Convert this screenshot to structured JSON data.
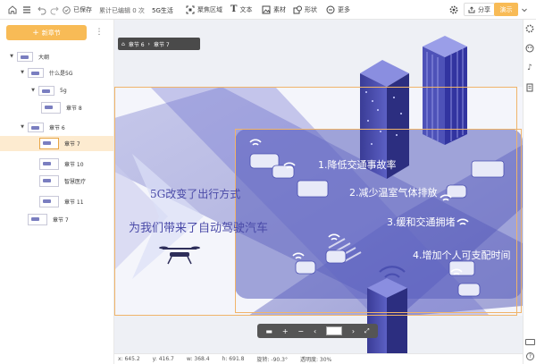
{
  "toolbar": {
    "saved_label": "已保存",
    "edit_count": "累计已编辑 0 次",
    "project_name": "5G生活",
    "focus_label": "聚焦区域",
    "text_label": "文本",
    "material_label": "素材",
    "shape_label": "形状",
    "more_label": "更多",
    "share_label": "分享",
    "present_label": "演示"
  },
  "sidebar": {
    "new_chapter": "新章节",
    "items": [
      {
        "label": "大纲",
        "level": 0
      },
      {
        "label": "什么是5G",
        "level": 1
      },
      {
        "label": "5g",
        "level": 2
      },
      {
        "label": "章节 8",
        "level": 3
      },
      {
        "label": "章节 6",
        "level": 1
      },
      {
        "label": "章节 7",
        "level": 2,
        "selected": true
      },
      {
        "label": "章节 10",
        "level": 2
      },
      {
        "label": "智慧医疗",
        "level": 2
      },
      {
        "label": "章节 11",
        "level": 2
      },
      {
        "label": "章节 7",
        "level": 1
      }
    ]
  },
  "breadcrumb": {
    "items": [
      "章节 6",
      "章节 7"
    ]
  },
  "slide": {
    "bullets": [
      "1.降低交通事故率",
      "2.减少温室气体排放",
      "3.缓和交通拥堵",
      "4.增加个人可支配时间"
    ],
    "caption_line1": "5G改变了出行方式",
    "caption_line2": "为我们带来了自动驾驶汽车"
  },
  "status": {
    "x": "x:   645.2",
    "y": "y:   416.7",
    "w": "w:   368.4",
    "h": "h:   691.8",
    "rotation": "旋转:  -90.3°",
    "opacity": "透明度:  30%"
  },
  "colors": {
    "accent": "#f8bb56",
    "slide_blue": "#4a4fb0",
    "tile_bg": "#ffffff"
  }
}
